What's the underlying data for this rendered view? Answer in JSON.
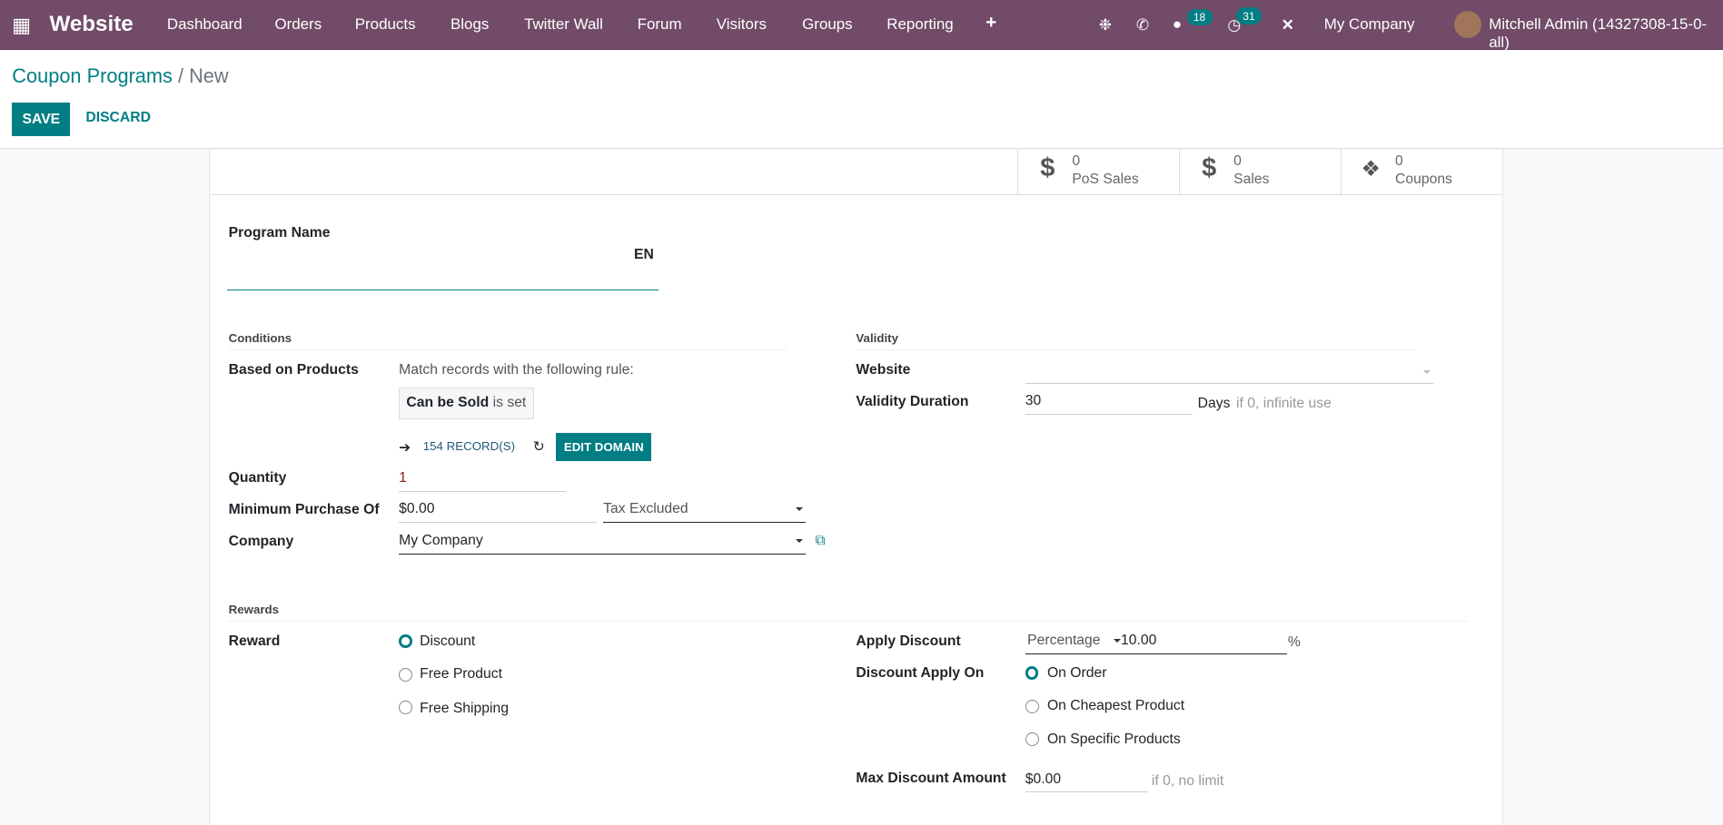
{
  "navbar": {
    "app": "Website",
    "menu": [
      "Dashboard",
      "Orders",
      "Products",
      "Blogs",
      "Twitter Wall",
      "Forum",
      "Visitors",
      "Groups",
      "Reporting"
    ],
    "messages_count": "18",
    "activities_count": "31",
    "company": "My Company",
    "user": "Mitchell Admin (14327308-15-0-all)"
  },
  "breadcrumb": {
    "parent": "Coupon Programs",
    "current": "New"
  },
  "actions": {
    "save": "SAVE",
    "discard": "DISCARD"
  },
  "stats": [
    {
      "value": "0",
      "label": "PoS Sales"
    },
    {
      "value": "0",
      "label": "Sales"
    },
    {
      "value": "0",
      "label": "Coupons"
    }
  ],
  "program_name": {
    "label": "Program Name",
    "value": "",
    "lang": "EN"
  },
  "conditions": {
    "title": "Conditions",
    "based_on_products": "Based on Products",
    "rule_text": "Match records with the following rule:",
    "rule_field": "Can be Sold",
    "rule_op": "is set",
    "records": "154 RECORD(S)",
    "edit_domain": "EDIT DOMAIN",
    "quantity_label": "Quantity",
    "quantity": "1",
    "min_purchase_label": "Minimum Purchase Of",
    "min_purchase": "$0.00",
    "tax": "Tax Excluded",
    "company_label": "Company",
    "company": "My Company"
  },
  "validity": {
    "title": "Validity",
    "website_label": "Website",
    "website": "",
    "duration_label": "Validity Duration",
    "duration": "30",
    "days": "Days",
    "hint": "if 0, infinite use"
  },
  "rewards": {
    "title": "Rewards",
    "reward_label": "Reward",
    "options": [
      "Discount",
      "Free Product",
      "Free Shipping"
    ],
    "selected": 0,
    "apply_discount_label": "Apply Discount",
    "discount_type": "Percentage",
    "discount_value": "10.00",
    "percent": "%",
    "apply_on_label": "Discount Apply On",
    "apply_on_options": [
      "On Order",
      "On Cheapest Product",
      "On Specific Products"
    ],
    "apply_on_selected": 0,
    "max_label": "Max Discount Amount",
    "max": "$0.00",
    "max_hint": "if 0, no limit"
  },
  "colors": {
    "navbar": "#714B67",
    "primary": "#017e84"
  }
}
